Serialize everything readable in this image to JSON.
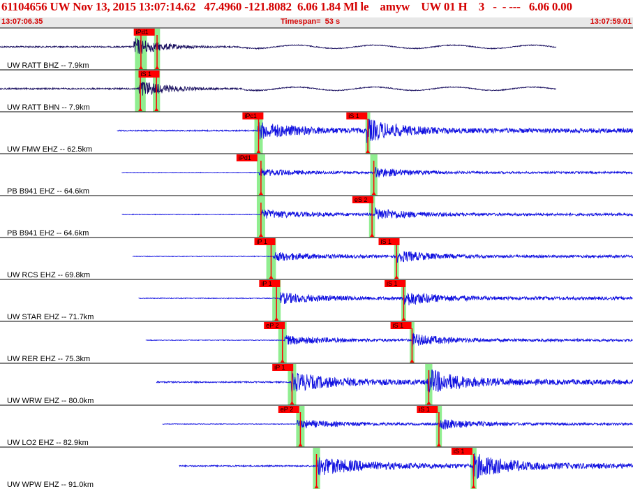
{
  "header": {
    "title": "61104656 UW Nov 13, 2015 13:07:14.62   47.4960 -121.8082  6.06 1.84 Ml le    amyw    UW 01 H    3   -  - ---   6.06 0.00",
    "start_time": "13:07:06.35",
    "timespan": "Timespan=  53 s",
    "end_time": "13:07:59.01"
  },
  "colors": {
    "header_text": "#d40000",
    "wave_dark": "#1a1060",
    "wave_blue": "#1010e0",
    "pick_red": "#ff0000",
    "window_green": "#90ee90",
    "label": "#000000"
  },
  "chart_data": {
    "type": "seismogram",
    "time_range_s": [
      0,
      53
    ],
    "traces": [
      {
        "label": "UW RATT BHZ -- 7.9km",
        "color": "dark",
        "start": 0.0,
        "end": 46.6,
        "amp": 0.22,
        "picks": [
          {
            "label": "iPd1",
            "t": 11.2,
            "green": [
              11.3,
              12.3
            ]
          },
          {
            "label": "",
            "t": 13.0,
            "green": [
              12.9,
              13.4
            ]
          }
        ],
        "onset": 11.2,
        "onset_s": 13.0
      },
      {
        "label": "UW RATT BHN -- 7.9km",
        "color": "dark",
        "start": 0.0,
        "end": 46.6,
        "amp": 0.22,
        "picks": [
          {
            "label": "iS 1",
            "t": 11.6,
            "green": [
              11.3,
              12.2
            ]
          },
          {
            "label": "",
            "t": 13.4,
            "green": [
              12.8,
              13.4
            ]
          }
        ],
        "onset": 11.6,
        "onset_s": 13.0
      },
      {
        "label": "UW FMW EHZ -- 62.5km",
        "color": "blue",
        "start": 9.8,
        "end": 56.1,
        "amp": 0.18,
        "picks": [
          {
            "label": "iPc1",
            "t": 20.3,
            "green": [
              21.3,
              22.0
            ]
          },
          {
            "label": "iS 1",
            "t": 29.0,
            "green": [
              30.6,
              31.0
            ]
          }
        ],
        "onset": 21.6,
        "onset_s": 30.7
      },
      {
        "label": "PB B941 EHZ -- 64.6km",
        "color": "blue",
        "start": 10.2,
        "end": 56.6,
        "amp": 0.08,
        "picks": [
          {
            "label": "iPd1",
            "t": 19.8,
            "green": [
              21.5,
              22.2
            ]
          },
          {
            "label": "",
            "t": 31.0,
            "green": [
              31.0,
              31.6
            ]
          }
        ],
        "onset": 21.7,
        "onset_s": 31.4
      },
      {
        "label": "PB B941 EH2 -- 64.6km",
        "color": "blue",
        "start": 10.2,
        "end": 56.6,
        "amp": 0.1,
        "picks": [
          {
            "label": "eS 2",
            "t": 29.5,
            "green": [
              21.5,
              22.2
            ]
          },
          {
            "label": "",
            "t": 31.0,
            "green": [
              30.9,
              31.4
            ]
          }
        ],
        "onset": 21.8,
        "onset_s": 31.4
      },
      {
        "label": "UW RCS EHZ -- 69.8km",
        "color": "blue",
        "start": 11.1,
        "end": 57.4,
        "amp": 0.1,
        "picks": [
          {
            "label": "iP 1",
            "t": 21.3,
            "green": [
              22.3,
              23.1
            ]
          },
          {
            "label": "iS 1",
            "t": 31.7,
            "green": [
              33.0,
              33.4
            ]
          }
        ],
        "onset": 22.9,
        "onset_s": 33.2
      },
      {
        "label": "UW STAR EHZ -- 71.7km",
        "color": "blue",
        "start": 11.6,
        "end": 57.8,
        "amp": 0.12,
        "picks": [
          {
            "label": "iP 1",
            "t": 21.7,
            "green": [
              22.8,
              23.5
            ]
          },
          {
            "label": "iS 1",
            "t": 32.2,
            "green": [
              33.6,
              34.0
            ]
          }
        ],
        "onset": 23.4,
        "onset_s": 33.8
      },
      {
        "label": "UW RER EHZ -- 75.3km",
        "color": "blue",
        "start": 12.2,
        "end": 58.5,
        "amp": 0.1,
        "picks": [
          {
            "label": "eP 2",
            "t": 22.1,
            "green": [
              23.3,
              24.0
            ]
          },
          {
            "label": "iS 1",
            "t": 32.7,
            "green": [
              34.3,
              34.7
            ]
          }
        ],
        "onset": 23.8,
        "onset_s": 34.5
      },
      {
        "label": "UW WRW EHZ -- 80.0km",
        "color": "blue",
        "start": 13.1,
        "end": 59.4,
        "amp": 0.2,
        "picks": [
          {
            "label": "iP 1",
            "t": 22.8,
            "green": [
              24.1,
              24.8
            ]
          },
          {
            "label": "",
            "t": 35.6,
            "green": [
              35.6,
              36.2
            ]
          }
        ],
        "onset": 24.4,
        "onset_s": 35.8
      },
      {
        "label": "UW LO2 EHZ -- 82.9km",
        "color": "blue",
        "start": 13.6,
        "end": 59.8,
        "amp": 0.09,
        "picks": [
          {
            "label": "eP 2",
            "t": 23.3,
            "green": [
              24.8,
              25.5
            ]
          },
          {
            "label": "iS 1",
            "t": 34.9,
            "green": [
              36.5,
              37.0
            ]
          }
        ],
        "onset": 24.9,
        "onset_s": 36.8
      },
      {
        "label": "UW WPW EHZ -- 91.0km",
        "color": "blue",
        "start": 15.0,
        "end": 61.2,
        "amp": 0.2,
        "picks": [
          {
            "label": "iS 1",
            "t": 37.8,
            "green": [
              39.4,
              39.9
            ]
          },
          {
            "label": "",
            "t": 26.2,
            "green": [
              26.2,
              26.8
            ]
          }
        ],
        "onset": 26.6,
        "onset_s": 39.6
      }
    ]
  }
}
